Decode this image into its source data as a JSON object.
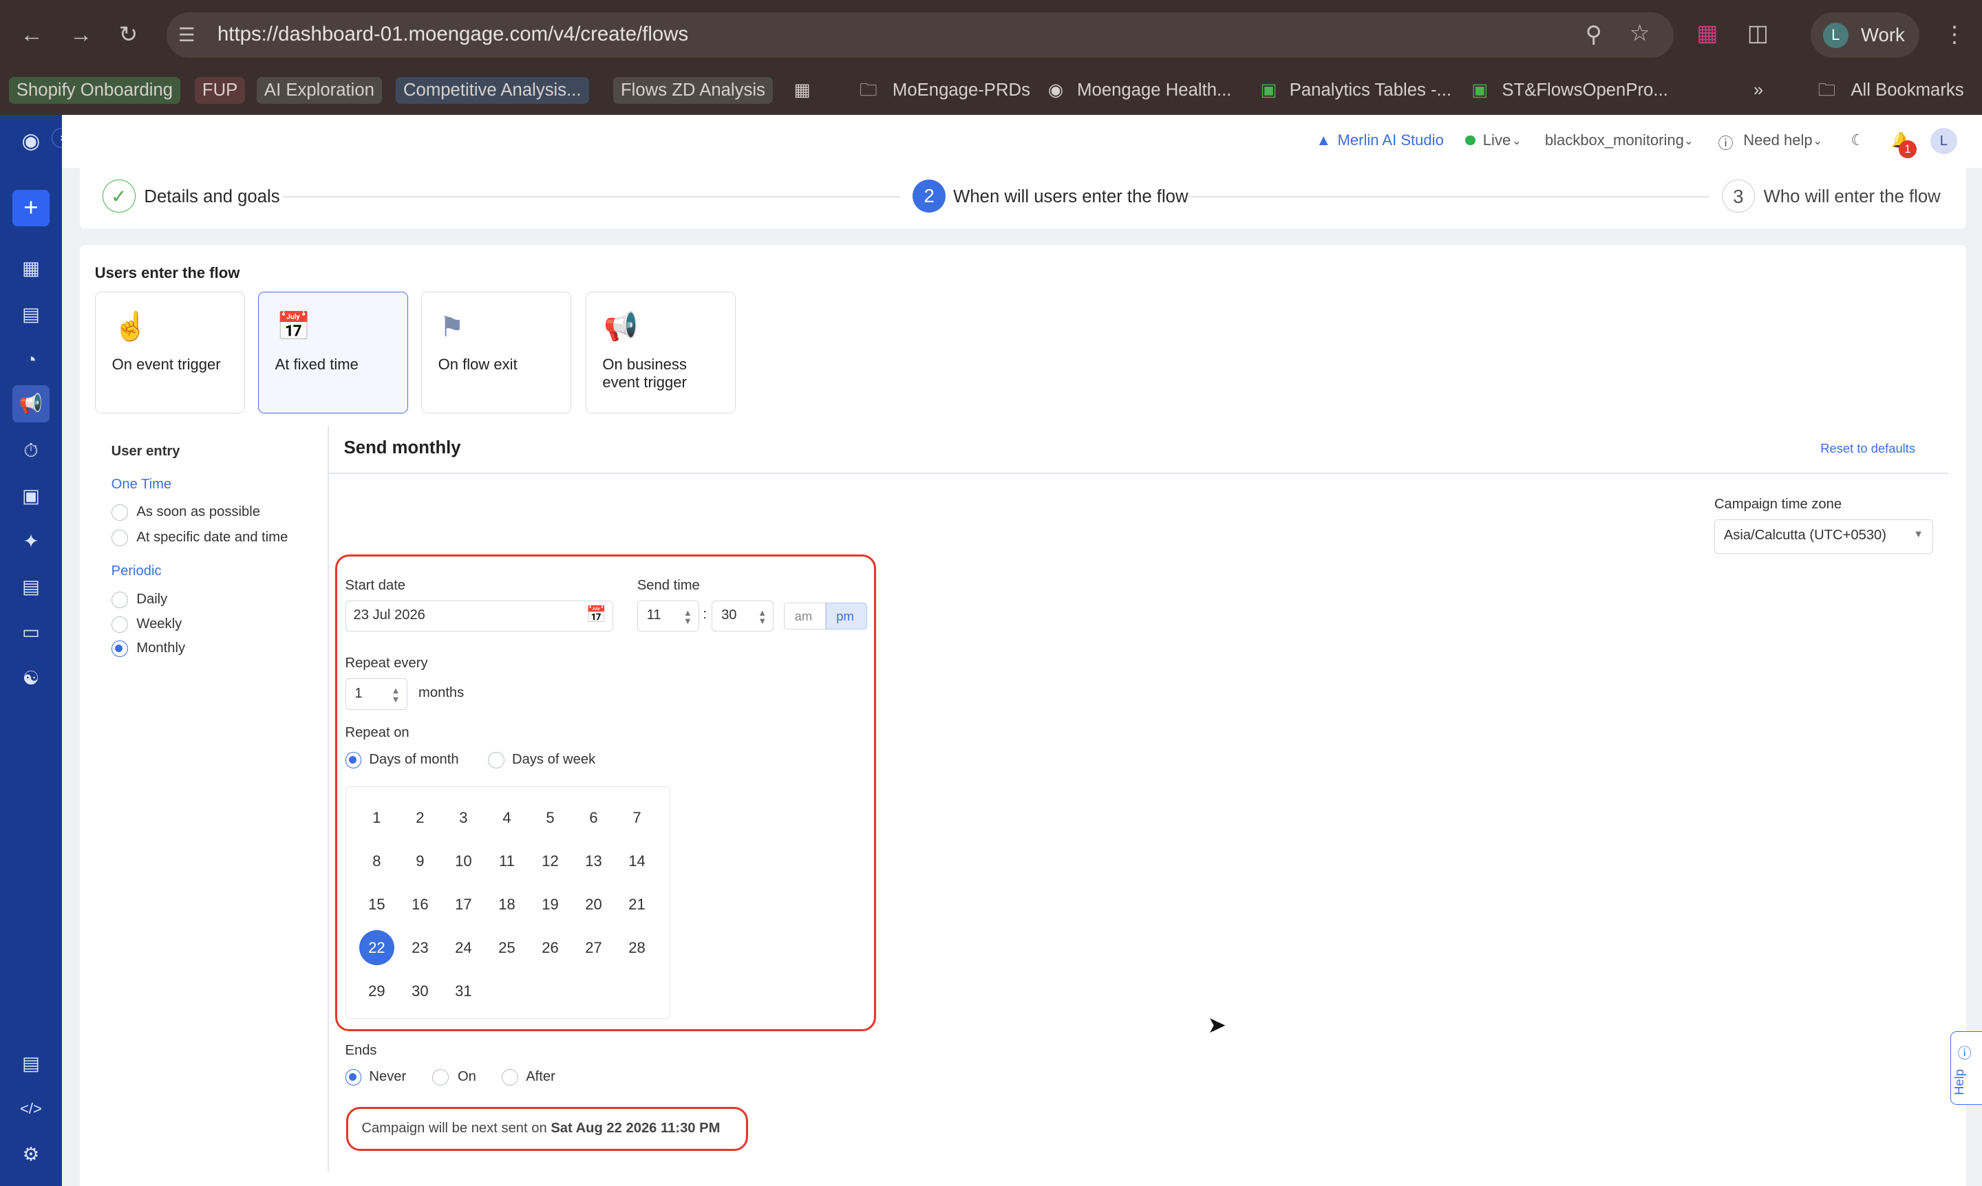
{
  "browser": {
    "url": "https://dashboard-01.moengage.com/v4/create/flows",
    "profile_initial": "L",
    "profile_name": "Work",
    "bookmarks": [
      {
        "label": "Shopify Onboarding",
        "color": "#3f5a3c"
      },
      {
        "label": "FUP",
        "color": "#5c3a3a"
      },
      {
        "label": "AI Exploration",
        "color": "#4e4a46"
      },
      {
        "label": "Competitive Analysis...",
        "color": "#3e4a5c"
      },
      {
        "label": "Flows ZD Analysis",
        "color": "#4e4a46"
      },
      {
        "label": "MoEngage-PRDs"
      },
      {
        "label": "Moengage Health..."
      },
      {
        "label": "Panalytics Tables -..."
      },
      {
        "label": "ST&FlowsOpenPro..."
      },
      {
        "label": "All Bookmarks"
      }
    ]
  },
  "topbar": {
    "merlin": "Merlin AI Studio",
    "env": "Live",
    "workspace": "blackbox_monitoring",
    "help": "Need help",
    "notif_count": "1",
    "avatar": "L"
  },
  "stepper": {
    "steps": [
      {
        "num": "✓",
        "label": "Details and goals"
      },
      {
        "num": "2",
        "label": "When will users enter the flow"
      },
      {
        "num": "3",
        "label": "Who will enter the flow"
      }
    ]
  },
  "entry": {
    "title": "Users enter the flow",
    "tiles": [
      {
        "label": "On event trigger",
        "icon": "pointer-icon"
      },
      {
        "label": "At fixed time",
        "icon": "calendar-clock-icon",
        "selected": true
      },
      {
        "label": "On flow exit",
        "icon": "flag-icon"
      },
      {
        "label": "On business event trigger",
        "icon": "megaphone-icon"
      }
    ]
  },
  "user_entry": {
    "title": "User entry",
    "one_time_label": "One Time",
    "one_time_options": [
      "As soon as possible",
      "At specific date and time"
    ],
    "periodic_label": "Periodic",
    "periodic_options": [
      "Daily",
      "Weekly",
      "Monthly"
    ],
    "selected": "Monthly"
  },
  "schedule": {
    "title": "Send monthly",
    "reset": "Reset to defaults",
    "tz_label": "Campaign time zone",
    "tz_value": "Asia/Calcutta (UTC+0530)",
    "start_date_label": "Start date",
    "start_date": "23 Jul 2026",
    "send_time_label": "Send time",
    "hour": "11",
    "colon": ":",
    "minute": "30",
    "am": "am",
    "pm": "pm",
    "meridiem_selected": "pm",
    "repeat_every_label": "Repeat every",
    "repeat_every": "1",
    "repeat_unit": "months",
    "repeat_on_label": "Repeat on",
    "repeat_on_options": [
      "Days of month",
      "Days of week"
    ],
    "repeat_on_selected": "Days of month",
    "days": [
      "1",
      "2",
      "3",
      "4",
      "5",
      "6",
      "7",
      "8",
      "9",
      "10",
      "11",
      "12",
      "13",
      "14",
      "15",
      "16",
      "17",
      "18",
      "19",
      "20",
      "21",
      "22",
      "23",
      "24",
      "25",
      "26",
      "27",
      "28",
      "29",
      "30",
      "31"
    ],
    "selected_day": "22",
    "ends_label": "Ends",
    "ends_options": [
      "Never",
      "On",
      "After"
    ],
    "ends_selected": "Never",
    "next_sent_prefix": "Campaign will be next sent on ",
    "next_sent_date": "Sat Aug 22 2026 11:30 PM"
  },
  "help_tab": "Help",
  "colors": {
    "accent": "#3b6ee0",
    "nav": "#1a3a8f",
    "highlight": "#e0392b"
  }
}
